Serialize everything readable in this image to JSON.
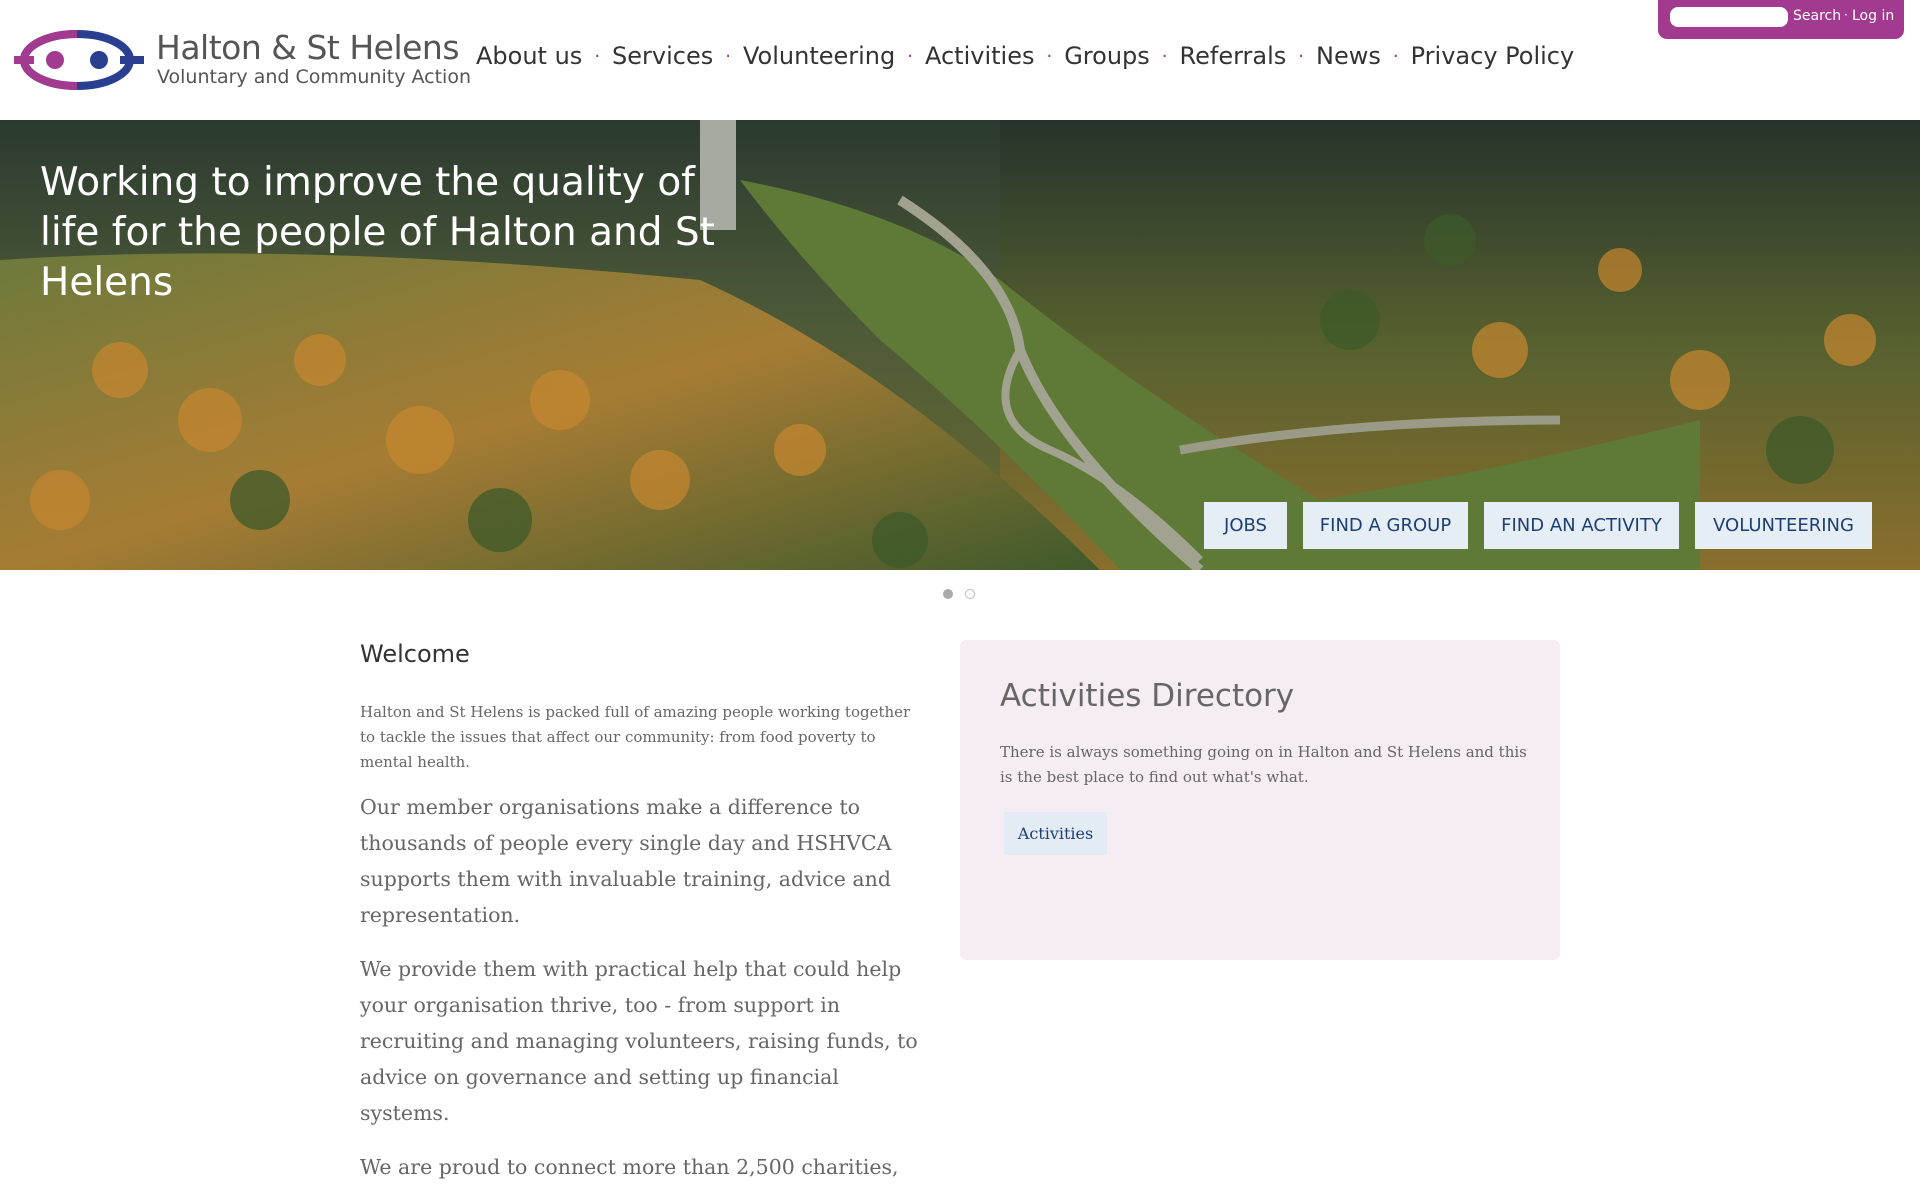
{
  "logo": {
    "title": "Halton & St Helens",
    "subtitle": "Voluntary and Community Action"
  },
  "nav": {
    "items": [
      {
        "label": "About us"
      },
      {
        "label": "Services"
      },
      {
        "label": "Volunteering"
      },
      {
        "label": "Activities"
      },
      {
        "label": "Groups"
      },
      {
        "label": "Referrals"
      },
      {
        "label": "News"
      },
      {
        "label": "Privacy Policy"
      }
    ],
    "separator": "·"
  },
  "utility": {
    "search_placeholder": "",
    "search_label": "Search",
    "separator": "·",
    "login_label": "Log in"
  },
  "hero": {
    "heading": "Working to improve the quality of life for the people of Halton and St Helens",
    "buttons": [
      {
        "label": "JOBS"
      },
      {
        "label": "FIND A GROUP"
      },
      {
        "label": "FIND AN ACTIVITY"
      },
      {
        "label": "VOLUNTEERING"
      }
    ],
    "slides": 2,
    "active_slide": 1
  },
  "welcome": {
    "heading": "Welcome",
    "intro": "Halton and St Helens is packed full of amazing people working together to tackle the issues that affect our community: from food poverty to mental health.",
    "paragraphs": [
      "Our member organisations make a difference to thousands of people every single day and HSHVCA supports them with invaluable training, advice and representation.",
      "We provide them with practical help that could help your organisation thrive, too - from support in recruiting and managing volunteers, raising funds, to advice on governance and setting up financial systems.",
      "We are proud to connect more than 2,500 charities,"
    ]
  },
  "directory": {
    "heading": "Activities Directory",
    "text": "There is always something going on in Halton and St Helens and this is the best place to find out what's what.",
    "button_label": "Activities"
  },
  "colors": {
    "brand_purple": "#a23a8f",
    "brand_blue": "#2a3f8f",
    "button_bg": "#e6eef5",
    "button_text": "#1e3f74",
    "panel_bg": "#f5ecf4"
  }
}
